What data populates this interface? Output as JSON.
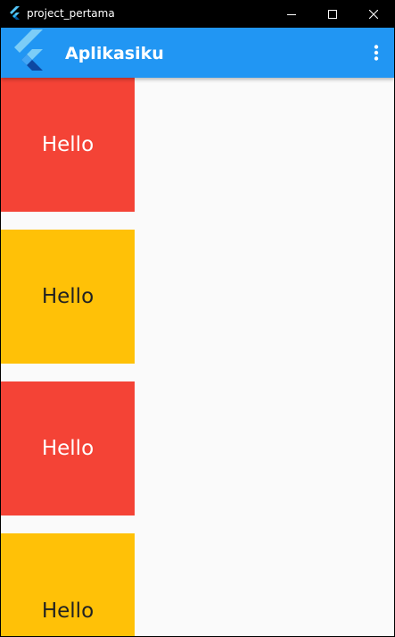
{
  "window": {
    "title": "project_pertama",
    "icon": "flutter-icon",
    "controls": [
      "minimize-icon",
      "maximize-icon",
      "close-icon"
    ]
  },
  "appbar": {
    "title": "Aplikasiku",
    "logo": "flutter-logo",
    "menu_icon": "more-vert-icon",
    "background": "#2196f3"
  },
  "boxes": [
    {
      "label": "Hello",
      "color": "#f44336"
    },
    {
      "label": "Hello",
      "color": "#ffc107"
    },
    {
      "label": "Hello",
      "color": "#f44336"
    },
    {
      "label": "Hello",
      "color": "#ffc107"
    }
  ]
}
